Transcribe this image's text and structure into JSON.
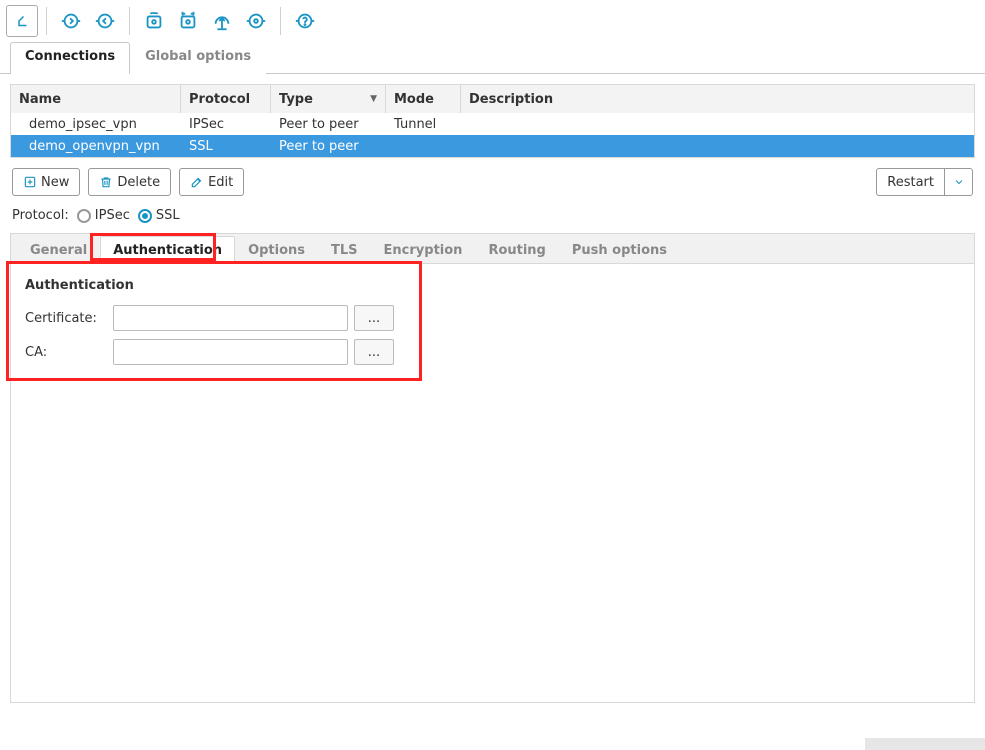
{
  "toolbar_icons": [
    "back",
    "circle-right",
    "circle-left",
    "eye-gear",
    "gear-sync",
    "upload",
    "gear-circle",
    "help"
  ],
  "top_tabs": {
    "items": [
      "Connections",
      "Global options"
    ],
    "active": 0
  },
  "grid": {
    "columns": {
      "name": "Name",
      "protocol": "Protocol",
      "type": "Type",
      "mode": "Mode",
      "description": "Description"
    },
    "sorted_col": "type",
    "rows": [
      {
        "name": "demo_ipsec_vpn",
        "protocol": "IPSec",
        "type": "Peer to peer",
        "mode": "Tunnel",
        "description": "",
        "selected": false
      },
      {
        "name": "demo_openvpn_vpn",
        "protocol": "SSL",
        "type": "Peer to peer",
        "mode": "",
        "description": "",
        "selected": true
      }
    ]
  },
  "actions": {
    "new": "New",
    "delete": "Delete",
    "edit": "Edit",
    "restart": "Restart"
  },
  "protocol_row": {
    "label": "Protocol:",
    "options": {
      "ipsec": "IPSec",
      "ssl": "SSL"
    },
    "selected": "ssl"
  },
  "inner_tabs": {
    "items": [
      "General",
      "Authentication",
      "Options",
      "TLS",
      "Encryption",
      "Routing",
      "Push options"
    ],
    "active": 1
  },
  "auth_panel": {
    "title": "Authentication",
    "fields": {
      "certificate": {
        "label": "Certificate:",
        "value": "",
        "browse": "..."
      },
      "ca": {
        "label": "CA:",
        "value": "",
        "browse": "..."
      }
    }
  }
}
